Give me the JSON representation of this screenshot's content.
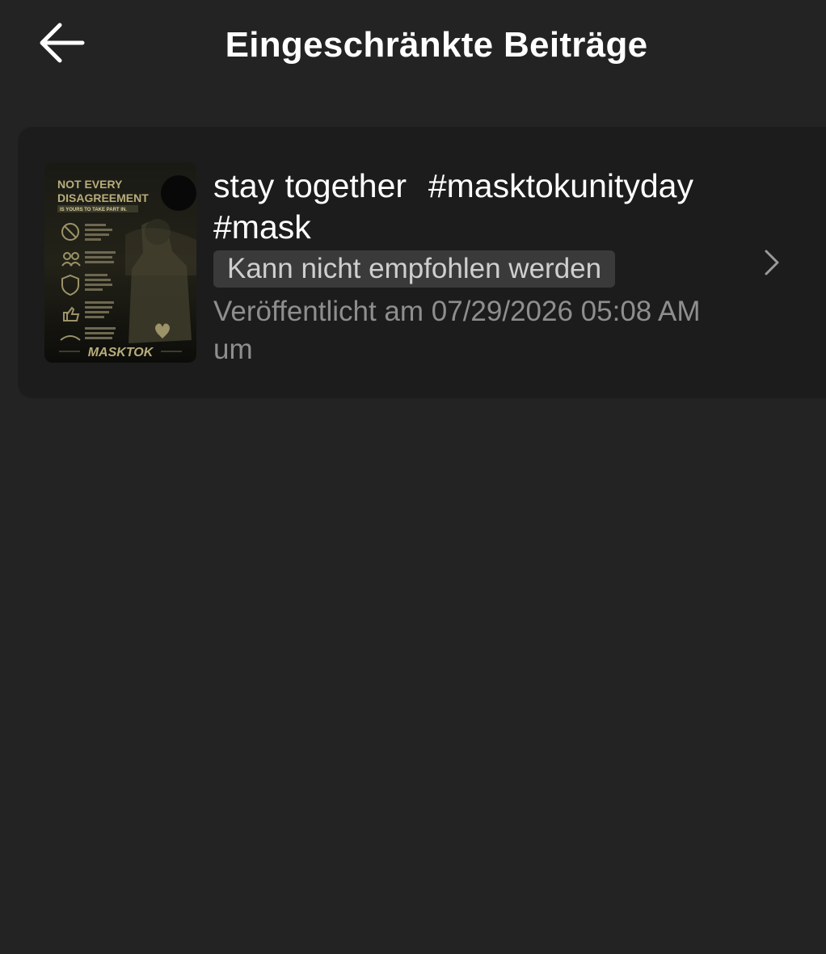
{
  "header": {
    "title": "Eingeschränkte Beiträge",
    "back_icon": "arrow-left-icon"
  },
  "post": {
    "caption_line1": "stay together  #masktokunityday",
    "caption_line2": "#mask",
    "status_badge": "Kann nicht empfohlen werden",
    "published_line1": "Veröffentlicht am 07/29/2026 05:08 AM",
    "published_line2": "um",
    "chevron_icon": "chevron-right-icon",
    "thumbnail": {
      "heading_line1": "NOT EVERY",
      "heading_line2": "DISAGREEMENT",
      "subheading": "IS YOURS TO TAKE PART IN.",
      "footer": "MASKTOK"
    }
  },
  "colors": {
    "background": "#232323",
    "card": "#1c1c1c",
    "badge": "#3a3a3a",
    "muted_text": "#8e8e8e",
    "thumbnail_accent": "#b8ad7a"
  }
}
